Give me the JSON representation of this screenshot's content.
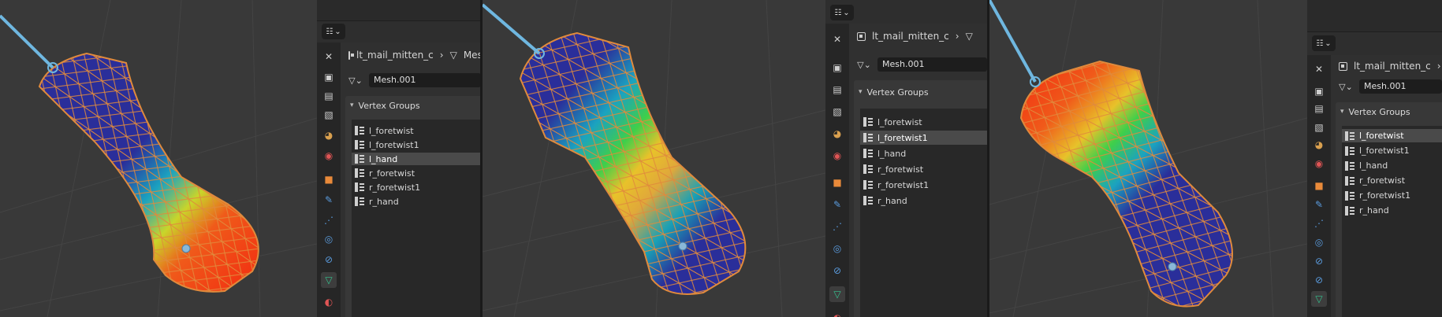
{
  "panels": [
    {
      "object_name": "lt_mail_mitten_c",
      "mesh_name": "Mesh.001",
      "crumb_extra": "Mes",
      "section_title": "Vertex Groups",
      "vertex_groups": [
        "l_foretwist",
        "l_foretwist1",
        "l_hand",
        "r_foretwist",
        "r_foretwist1",
        "r_hand"
      ],
      "selected_index": 2
    },
    {
      "object_name": "lt_mail_mitten_c",
      "mesh_name": "Mesh.001",
      "crumb_extra": "",
      "section_title": "Vertex Groups",
      "vertex_groups": [
        "l_foretwist",
        "l_foretwist1",
        "l_hand",
        "r_foretwist",
        "r_foretwist1",
        "r_hand"
      ],
      "selected_index": 1
    },
    {
      "object_name": "lt_mail_mitten_c",
      "mesh_name": "Mesh.001",
      "crumb_extra": "",
      "section_title": "Vertex Groups",
      "vertex_groups": [
        "l_foretwist",
        "l_foretwist1",
        "l_hand",
        "r_foretwist",
        "r_foretwist1",
        "r_hand"
      ],
      "selected_index": 0
    }
  ],
  "tab_icons": [
    "tool-icon",
    "render-icon",
    "output-icon",
    "view-layer-icon",
    "scene-icon",
    "world-icon",
    "object-icon",
    "modifier-icon",
    "particles-icon",
    "physics-icon",
    "constraints-icon",
    "data-icon",
    "material-icon"
  ],
  "colors": {
    "viewport_bg": "#393939",
    "wire": "#e08a3c",
    "bone": "#6fb7e0",
    "active_tab": "#35c48f"
  }
}
